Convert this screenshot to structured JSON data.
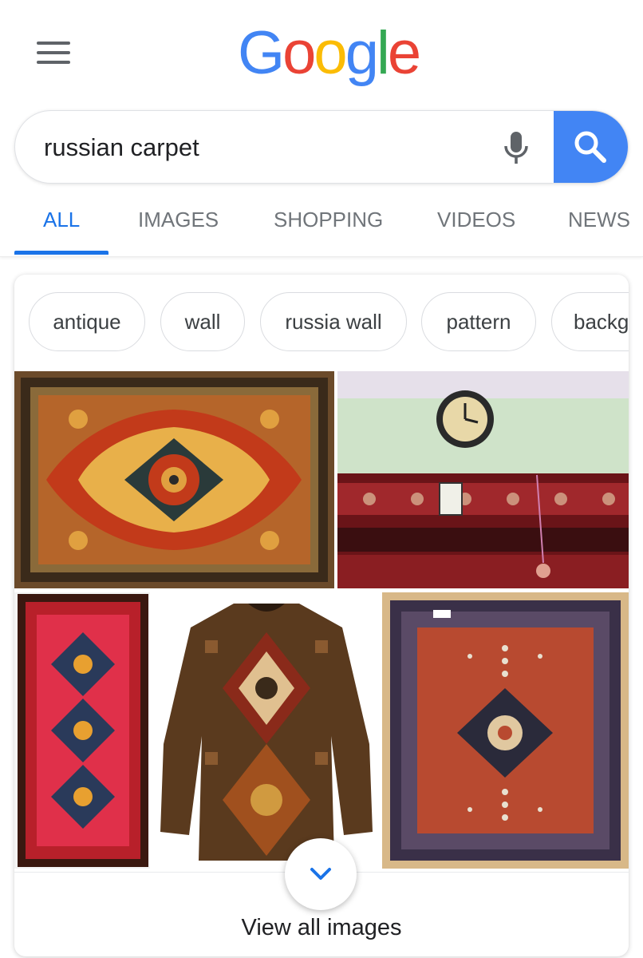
{
  "header": {
    "logo_letters": [
      "G",
      "o",
      "o",
      "g",
      "l",
      "e"
    ],
    "logo_colors": [
      "#4285f4",
      "#ea4335",
      "#fbbc05",
      "#4285f4",
      "#34a853",
      "#ea4335"
    ],
    "menu_icon": "hamburger-menu-icon"
  },
  "search": {
    "value": "russian carpet",
    "mic_icon": "microphone-icon",
    "search_icon": "magnifier-icon",
    "button_color": "#4285f4"
  },
  "tabs": [
    {
      "label": "ALL",
      "active": true
    },
    {
      "label": "IMAGES",
      "active": false
    },
    {
      "label": "SHOPPING",
      "active": false
    },
    {
      "label": "VIDEOS",
      "active": false
    },
    {
      "label": "NEWS",
      "active": false
    }
  ],
  "images_card": {
    "chips": [
      "antique",
      "wall",
      "russia wall",
      "pattern",
      "backg"
    ],
    "images": [
      "red-persian-carpet-medallion",
      "carpet-hanging-on-wall-with-clock",
      "red-runner-rug",
      "carpet-pattern-sweatshirt",
      "red-rug-with-medallion"
    ],
    "expand_icon": "chevron-down-icon",
    "view_all_label": "View all images"
  },
  "colors": {
    "accent": "#1a73e8",
    "tab_inactive": "#70757a"
  }
}
